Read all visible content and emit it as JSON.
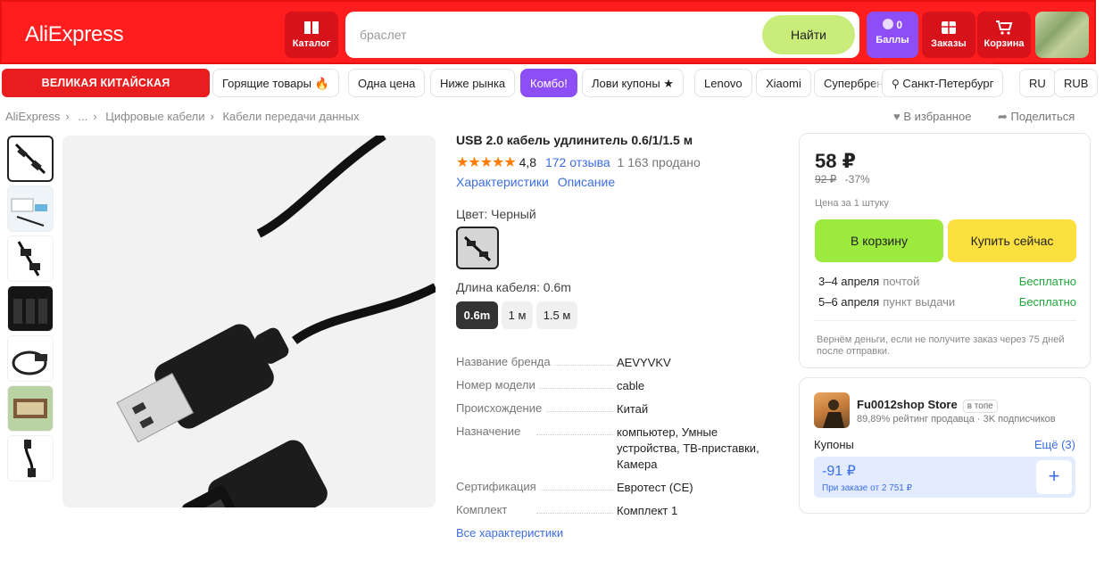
{
  "header": {
    "logo": "AliExpress",
    "catalog_label": "Каталог",
    "search_placeholder": "браслет",
    "search_button": "Найти",
    "points_count": "0",
    "points_label": "Баллы",
    "orders_label": "Заказы",
    "cart_label": "Корзина",
    "accent_color": "#ff1d1d"
  },
  "nav": {
    "promo": "ВЕЛИКАЯ КИТАЙСКАЯ РАСПРОДАЖА",
    "items": [
      "Горящие товары 🔥",
      "Одна цена",
      "Ниже рынка",
      "Комбо!",
      "Лови купоны ★",
      "Lenovo",
      "Xiaomi",
      "Супербренды"
    ],
    "city": "Санкт-Петербург",
    "language": "RU",
    "currency": "RUB"
  },
  "breadcrumbs": [
    "AliExpress",
    "...",
    "Цифровые кабели",
    "Кабели передачи данных"
  ],
  "actions": {
    "favorite": "В избранное",
    "share": "Поделиться"
  },
  "product": {
    "title": "USB 2.0 кабель удлинитель 0.6/1/1.5 м",
    "rating": "4,8",
    "reviews": "172 отзыва",
    "sold": "1 163 продано",
    "tab_specs": "Характеристики",
    "tab_description": "Описание",
    "color_label": "Цвет: Черный",
    "length_label": "Длина кабеля: 0.6m",
    "lengths": [
      "0.6m",
      "1 м",
      "1.5 м"
    ],
    "specs": [
      {
        "key": "Название бренда",
        "value": "AEVYVKV"
      },
      {
        "key": "Номер модели",
        "value": "cable"
      },
      {
        "key": "Происхождение",
        "value": "Китай"
      },
      {
        "key": "Назначение",
        "value": "компьютер, Умные устройства, ТВ-приставки, Камера"
      },
      {
        "key": "Сертификация",
        "value": "Евротест (CE)"
      },
      {
        "key": "Комплект",
        "value": "Комплект 1"
      }
    ],
    "all_specs": "Все характеристики"
  },
  "purchase": {
    "price": "58 ₽",
    "old_price": "92 ₽",
    "discount": "-37%",
    "unit_note": "Цена за 1 штуку",
    "add_to_cart": "В корзину",
    "buy_now": "Купить сейчас",
    "delivery": [
      {
        "date": "3–4 апреля",
        "method": "почтой",
        "cost": "Бесплатно"
      },
      {
        "date": "5–6 апреля",
        "method": "пункт выдачи",
        "cost": "Бесплатно"
      }
    ],
    "refund": "Вернём деньги, если не получите заказ через 75 дней после отправки."
  },
  "store": {
    "name": "Fu0012shop Store",
    "badge": "в топе",
    "meta": "89,89% рейтинг продавца · 3K подписчиков",
    "coupons_label": "Купоны",
    "more": "Ещё (3)",
    "coupon_amount": "-91 ₽",
    "coupon_condition": "При заказе от 2 751 ₽",
    "coupon_add": "+"
  }
}
